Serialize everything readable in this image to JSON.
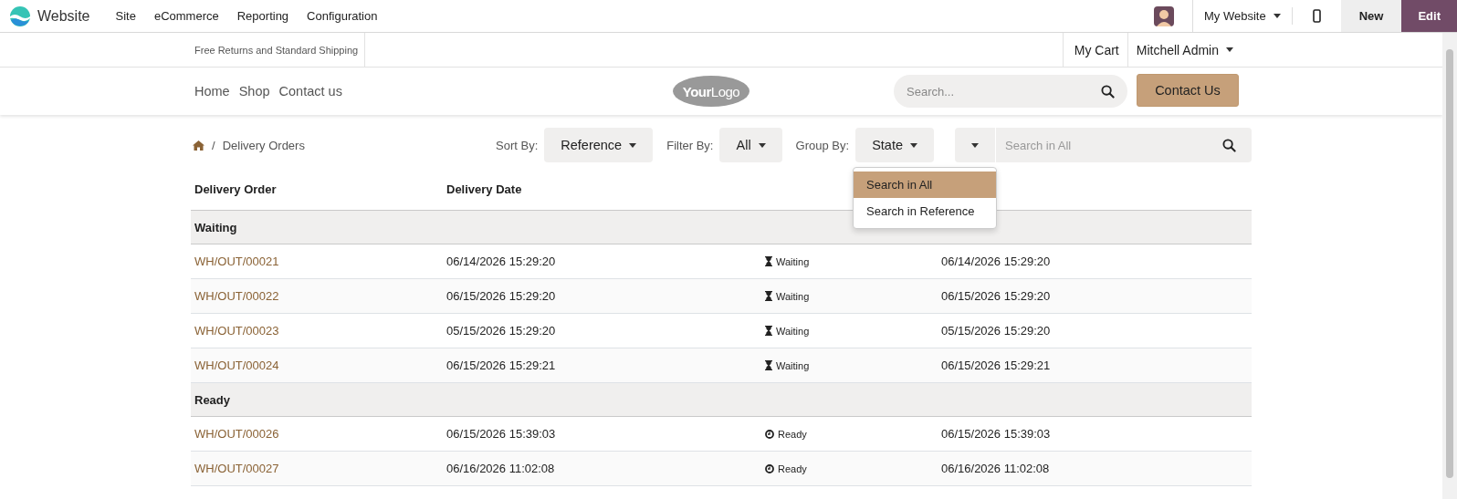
{
  "topbar": {
    "app_name": "Website",
    "menu": [
      "Site",
      "eCommerce",
      "Reporting",
      "Configuration"
    ],
    "website_switcher": "My Website",
    "buttons": [
      {
        "kind": "new",
        "label": "New"
      },
      {
        "kind": "edit",
        "label": "Edit"
      }
    ]
  },
  "header": {
    "announcement": "Free Returns and Standard Shipping",
    "cart": "My Cart",
    "user": "Mitchell Admin",
    "nav": [
      "Home",
      "Shop",
      "Contact us"
    ],
    "logo_text": [
      "Your",
      "Logo"
    ],
    "search": {
      "placeholder": "Search..."
    },
    "cta": "Contact Us"
  },
  "breadcrumb": {
    "separator": "/",
    "items": [
      "Delivery Orders"
    ]
  },
  "controls": [
    {
      "label": "Sort By:",
      "value": "Reference"
    },
    {
      "label": "Filter By:",
      "value": "All"
    },
    {
      "label": "Group By:",
      "value": "State"
    }
  ],
  "search": {
    "placeholder": "Search in All"
  },
  "search_dropdown": [
    {
      "label": "Search in All",
      "selected": true
    },
    {
      "label": "Search in Reference",
      "selected": false
    }
  ],
  "table": {
    "columns": [
      "Delivery Order",
      "Delivery Date"
    ],
    "groups": [
      {
        "name": "Waiting",
        "rows": [
          {
            "reference": "WH/OUT/00021",
            "date": "06/14/2026 15:29:20",
            "state": {
              "kind": "waiting",
              "label": "Waiting"
            },
            "date_2": "06/14/2026 15:29:20"
          },
          {
            "reference": "WH/OUT/00022",
            "date": "06/15/2026 15:29:20",
            "state": {
              "kind": "waiting",
              "label": "Waiting"
            },
            "date_2": "06/15/2026 15:29:20"
          },
          {
            "reference": "WH/OUT/00023",
            "date": "05/15/2026 15:29:20",
            "state": {
              "kind": "waiting",
              "label": "Waiting"
            },
            "date_2": "05/15/2026 15:29:20"
          },
          {
            "reference": "WH/OUT/00024",
            "date": "06/15/2026 15:29:21",
            "state": {
              "kind": "waiting",
              "label": "Waiting"
            },
            "date_2": "06/15/2026 15:29:21"
          }
        ]
      },
      {
        "name": "Ready",
        "rows": [
          {
            "reference": "WH/OUT/00026",
            "date": "06/15/2026 15:39:03",
            "state": {
              "kind": "ready",
              "label": "Ready"
            },
            "date_2": "06/15/2026 15:39:03"
          },
          {
            "reference": "WH/OUT/00027",
            "date": "06/16/2026 11:02:08",
            "state": {
              "kind": "ready",
              "label": "Ready"
            },
            "date_2": "06/16/2026 11:02:08"
          }
        ]
      }
    ]
  }
}
